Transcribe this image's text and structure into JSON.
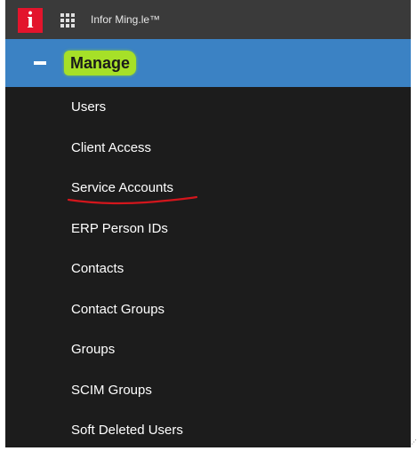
{
  "header": {
    "logo_letter": "i",
    "app_title": "Infor Ming.le™",
    "apps_icon": "grid-apps-icon"
  },
  "section": {
    "label": "Manage",
    "toggle_icon": "minus-collapse-icon",
    "highlight_color": "#a6e028",
    "bar_color": "#3b82c4"
  },
  "menu": {
    "items": [
      {
        "label": "Users"
      },
      {
        "label": "Client Access"
      },
      {
        "label": "Service Accounts"
      },
      {
        "label": "ERP Person IDs"
      },
      {
        "label": "Contacts"
      },
      {
        "label": "Contact Groups"
      },
      {
        "label": "Groups"
      },
      {
        "label": "SCIM Groups"
      },
      {
        "label": "Soft Deleted Users"
      }
    ],
    "annotation_color": "#d3161c"
  },
  "colors": {
    "logo_red": "#e3142c",
    "topbar": "#3a3a3a",
    "panel": "#1c1c1c"
  }
}
